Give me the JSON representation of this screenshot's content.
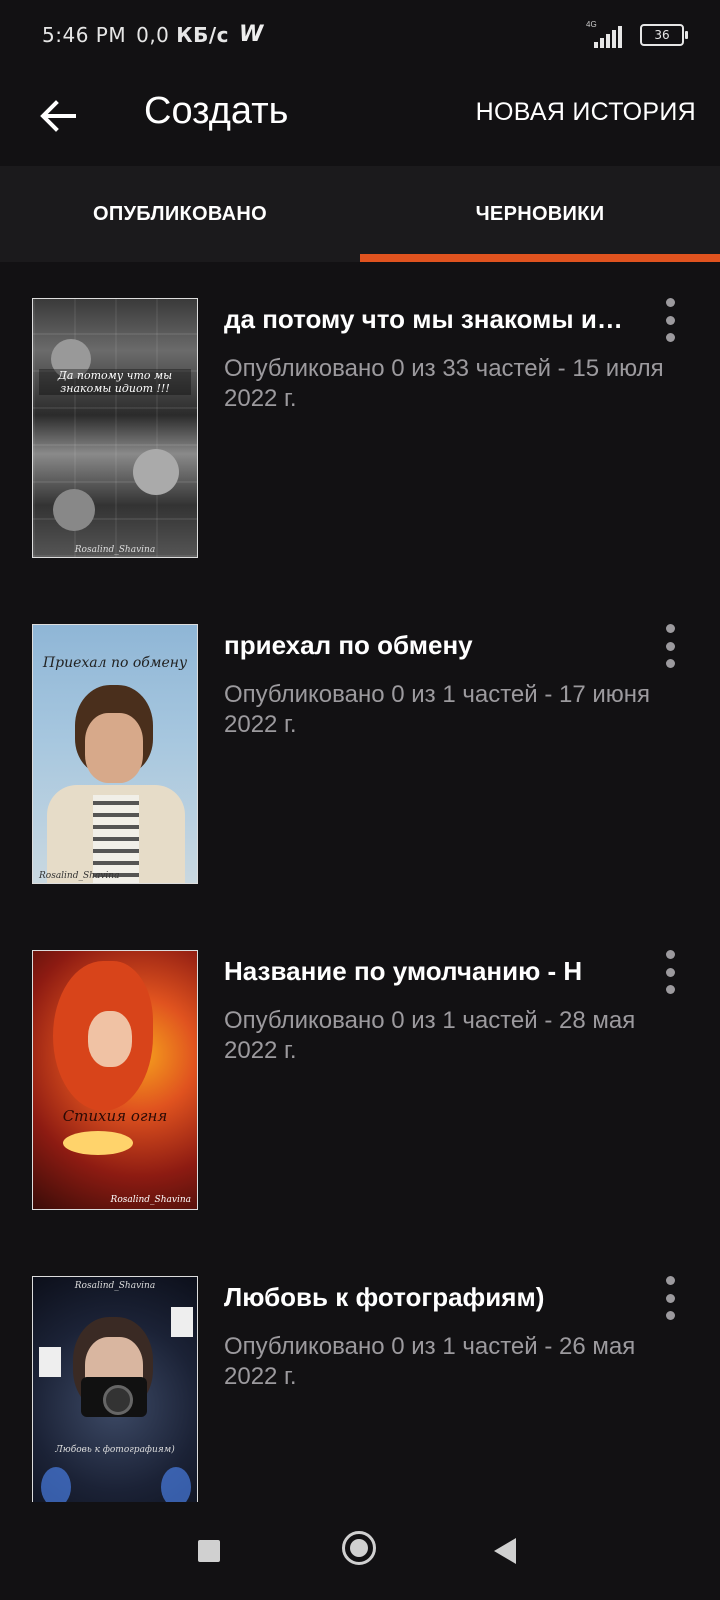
{
  "status_bar": {
    "time": "5:46 PM",
    "speed_value": "0,0",
    "speed_unit": "КБ/с",
    "app_icon_glyph": "W",
    "network_label": "4G",
    "battery": "36"
  },
  "toolbar": {
    "title": "Создать",
    "new_story_label": "НОВАЯ ИСТОРИЯ"
  },
  "tabs": [
    {
      "label": "ОПУБЛИКОВАНО",
      "active": false
    },
    {
      "label": "ЧЕРНОВИКИ",
      "active": true
    }
  ],
  "accent_color": "#e0531f",
  "stories": [
    {
      "title": "да потому что мы знакомы идиот",
      "meta": "Опубликовано 0 из 33 частей - 15 июля 2022 г.",
      "cover_text": "Да потому что мы знакомы идиот !!!",
      "cover_signature": "Rosalind_Shavina"
    },
    {
      "title": "приехал по обмену",
      "meta": "Опубликовано 0 из 1 частей - 17 июня 2022 г.",
      "cover_text": "Приехал по обмену",
      "cover_signature": "Rosalind_Shavina"
    },
    {
      "title": "Название по умолчанию - Н",
      "meta": "Опубликовано 0 из 1 частей - 28 мая 2022 г.",
      "cover_text": "Стихия огня",
      "cover_signature": "Rosalind_Shavina"
    },
    {
      "title": "Любовь к фотографиям)",
      "meta": "Опубликовано 0 из 1 частей - 26 мая 2022 г.",
      "cover_text": "Любовь к фотографиям)",
      "cover_signature": "Rosalind_Shavina"
    }
  ]
}
